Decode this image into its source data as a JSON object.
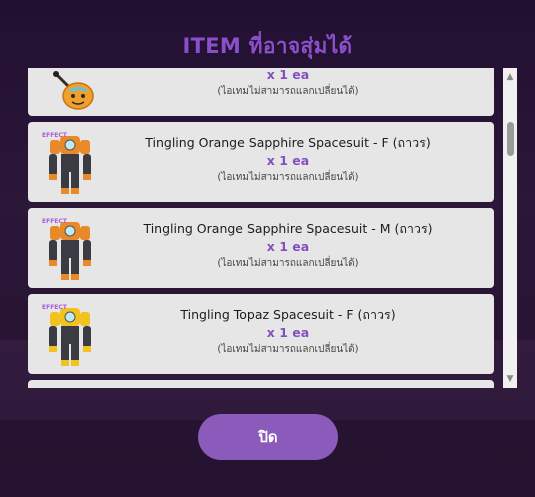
{
  "dialog": {
    "title": "ITEM ที่อาจสุ่มได้",
    "close_label": "ปิด"
  },
  "items": [
    {
      "name": "",
      "qty": "x 1 ea",
      "note": "(ไอเทมไม่สามารถแลกเปลี่ยนได้)",
      "icon": "pumpkin-lollipop-icon"
    },
    {
      "name": "Tingling Orange Sapphire Spacesuit - F (ถาวร)",
      "qty": "x 1 ea",
      "note": "(ไอเทมไม่สามารถแลกเปลี่ยนได้)",
      "icon": "spacesuit-orange-icon"
    },
    {
      "name": "Tingling Orange Sapphire Spacesuit - M (ถาวร)",
      "qty": "x 1 ea",
      "note": "(ไอเทมไม่สามารถแลกเปลี่ยนได้)",
      "icon": "spacesuit-orange-icon"
    },
    {
      "name": "Tingling Topaz Spacesuit - F (ถาวร)",
      "qty": "x 1 ea",
      "note": "(ไอเทมไม่สามารถแลกเปลี่ยนได้)",
      "icon": "spacesuit-topaz-icon"
    },
    {
      "name": "",
      "qty": "",
      "note": "",
      "icon": "partial-item-icon"
    }
  ],
  "scroll": {
    "up_icon": "scroll-up-arrow-icon",
    "down_icon": "scroll-down-arrow-icon",
    "position_fraction": 0.12
  },
  "colors": {
    "title": "#8a4fc9",
    "qty": "#8450c0",
    "button": "#8a5bbb",
    "card": "#e6e6e6"
  }
}
